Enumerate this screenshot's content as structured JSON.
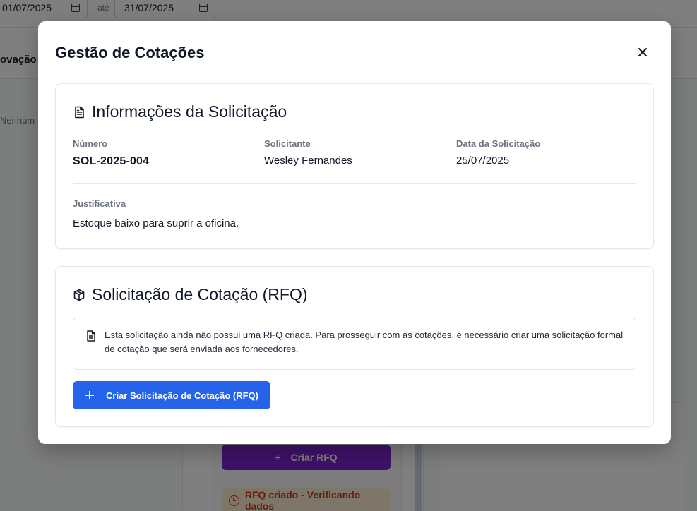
{
  "background": {
    "date_from": "01/07/2025",
    "date_to": "31/07/2025",
    "date_separator": "até",
    "tab_partial": "ovação",
    "empty_partial": "Nenhum",
    "rfq_button_label": "Criar RFQ",
    "status_label": "RFQ criado - Verificando dados"
  },
  "modal": {
    "title": "Gestão de Cotações",
    "info_card": {
      "title": "Informações da Solicitação",
      "numero_label": "Número",
      "numero_value": "SOL-2025-004",
      "solicitante_label": "Solicitante",
      "solicitante_value": "Wesley Fernandes",
      "data_label": "Data da Solicitação",
      "data_value": "25/07/2025",
      "justificativa_label": "Justificativa",
      "justificativa_value": "Estoque baixo para suprir a oficina."
    },
    "rfq_card": {
      "title": "Solicitação de Cotação (RFQ)",
      "notice": "Esta solicitação ainda não possui uma RFQ criada. Para prosseguir com as cotações, é necessário criar uma solicitação formal de cotação que será enviada aos fornecedores.",
      "create_button_label": "Criar Solicitação de Cotação (RFQ)"
    }
  },
  "colors": {
    "primary": "#2563eb",
    "purple": "#7e22ce",
    "warning_bg": "#ffedd5",
    "warning_text": "#c2410c"
  },
  "icons": {
    "close": "close-icon",
    "info_title": "file-text-icon",
    "rfq_title": "package-icon",
    "notice": "file-text-icon",
    "create": "plus-icon",
    "calendar": "calendar-icon",
    "clock": "clock-icon"
  }
}
